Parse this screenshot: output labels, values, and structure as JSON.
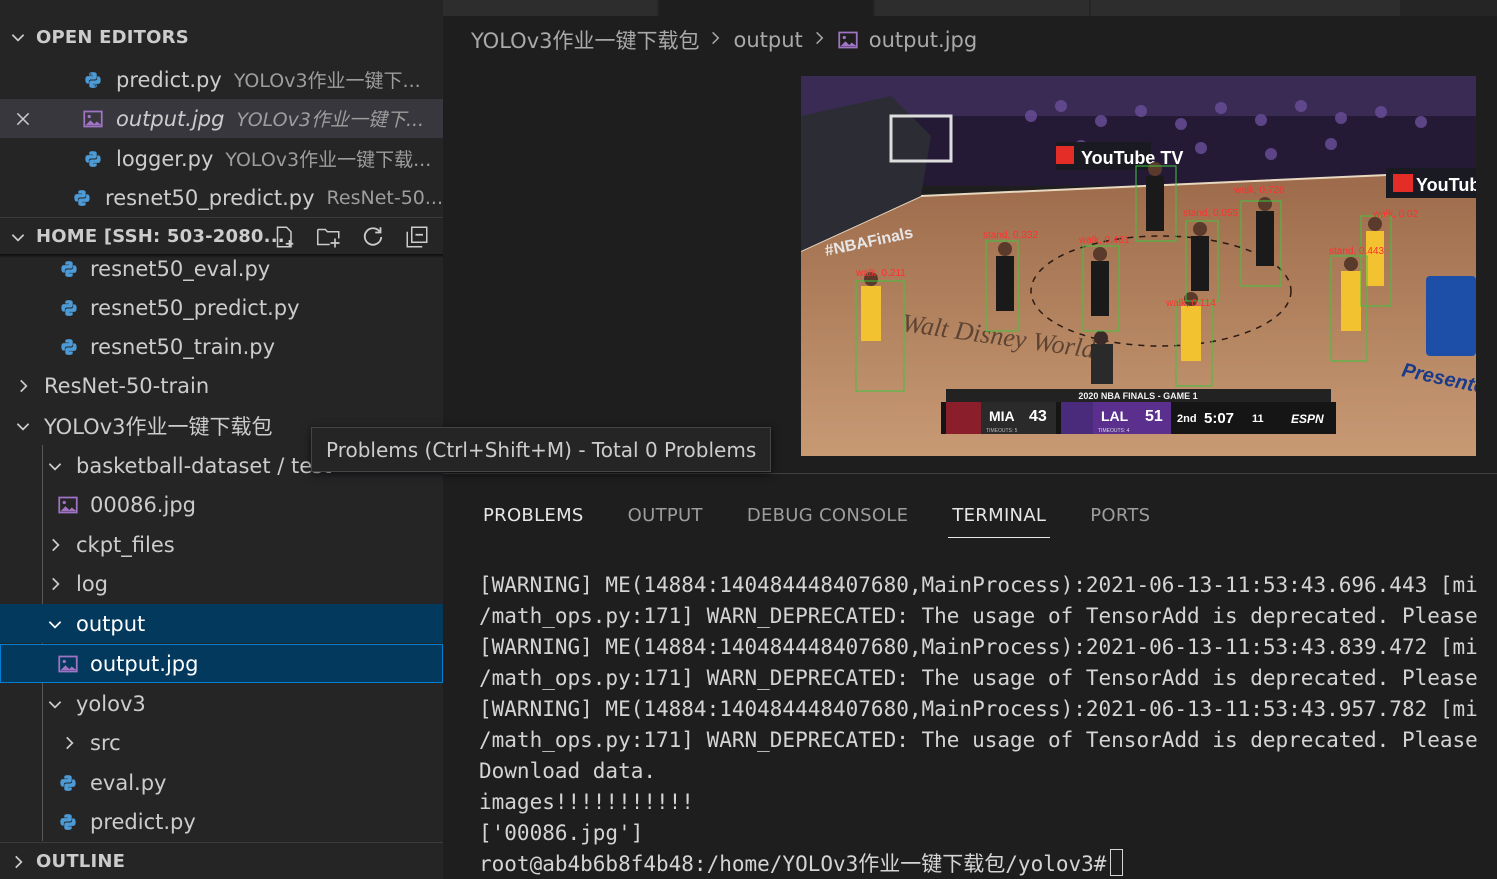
{
  "colors": {
    "accent": "#007fd4",
    "selection": "#04395e",
    "python_icon": "#4d9bd6",
    "image_icon": "#a074c4"
  },
  "open_editors": {
    "title": "OPEN EDITORS",
    "items": [
      {
        "name": "predict.py",
        "desc": "YOLOv3作业一键下...",
        "icon": "python-icon"
      },
      {
        "name": "output.jpg",
        "desc": "YOLOv3作业一键下...",
        "icon": "image-icon"
      },
      {
        "name": "logger.py",
        "desc": "YOLOv3作业一键下载...",
        "icon": "python-icon"
      },
      {
        "name": "resnet50_predict.py",
        "desc": "ResNet-50...",
        "icon": "python-icon"
      }
    ]
  },
  "explorer": {
    "title": "HOME [SSH: 503-2080...",
    "items": [
      "resnet50_eval.py",
      "resnet50_predict.py",
      "resnet50_train.py",
      "ResNet-50-train",
      "YOLOv3作业一键下载包",
      "basketball-dataset / test",
      "00086.jpg",
      "ckpt_files",
      "log",
      "output",
      "output.jpg",
      "yolov3",
      "src",
      "eval.py",
      "predict.py"
    ]
  },
  "outline": {
    "title": "OUTLINE"
  },
  "breadcrumb": {
    "folder": "YOLOv3作业一键下载包",
    "sub": "output",
    "file": "output.jpg"
  },
  "tooltip": "Problems (Ctrl+Shift+M) - Total 0 Problems",
  "panel": {
    "tabs": [
      "PROBLEMS",
      "OUTPUT",
      "DEBUG CONSOLE",
      "TERMINAL",
      "PORTS"
    ],
    "active_tab": "TERMINAL",
    "lines": [
      "[WARNING] ME(14884:140484448407680,MainProcess):2021-06-13-11:53:43.696.443 [mi",
      "/math_ops.py:171] WARN_DEPRECATED: The usage of TensorAdd is deprecated. Please",
      "[WARNING] ME(14884:140484448407680,MainProcess):2021-06-13-11:53:43.839.472 [mi",
      "/math_ops.py:171] WARN_DEPRECATED: The usage of TensorAdd is deprecated. Please",
      "[WARNING] ME(14884:140484448407680,MainProcess):2021-06-13-11:53:43.957.782 [mi",
      "/math_ops.py:171] WARN_DEPRECATED: The usage of TensorAdd is deprecated. Please",
      "Download data.",
      "images!!!!!!!!!!!",
      "['00086.jpg']"
    ],
    "prompt": "root@ab4b6b8f4b48:/home/YOLOv3作业一键下载包/yolov3#"
  },
  "image": {
    "scoreboard": {
      "title": "2020 NBA FINALS - GAME 1",
      "home": "MIA",
      "home_score": "43",
      "home_timeouts": "TIMEOUTS: 5",
      "away": "LAL",
      "away_score": "51",
      "away_timeouts": "TIMEOUTS: 4",
      "quarter": "2nd",
      "clock": "5:07",
      "shot_clock": "11",
      "network": "ESPN"
    },
    "banners": [
      "YouTube TV",
      "YouTube",
      "#NBAFinals",
      "Presented",
      "Walt Disney World"
    ],
    "detections": [
      "stand, 0.332",
      "walk, 0.461",
      "walk, 0.726",
      "stand, 0.055",
      "walk, 0.02",
      "stand, 0.443",
      "walk, 0.114",
      "walk, 0.211"
    ]
  }
}
